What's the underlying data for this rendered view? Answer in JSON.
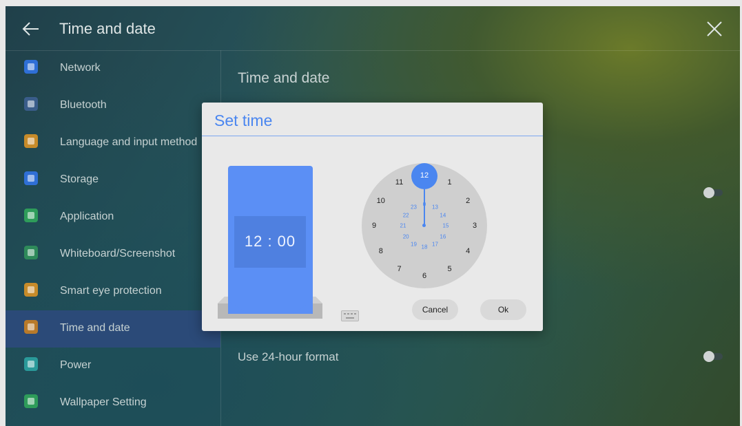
{
  "header": {
    "title": "Time and date",
    "back_icon": "arrow-left-icon",
    "close_icon": "close-icon"
  },
  "sidebar": {
    "items": [
      {
        "label": "Network",
        "icon": "globe-icon",
        "color": "#2f6fd6"
      },
      {
        "label": "Bluetooth",
        "icon": "bluetooth-icon",
        "color": "#3a5d8a"
      },
      {
        "label": "Language and input method",
        "icon": "keyboard-icon",
        "color": "#c78b2a"
      },
      {
        "label": "Storage",
        "icon": "storage-icon",
        "color": "#2f6fd6"
      },
      {
        "label": "Application",
        "icon": "apps-icon",
        "color": "#2e9c5a"
      },
      {
        "label": "Whiteboard/Screenshot",
        "icon": "whiteboard-icon",
        "color": "#2e8a5a"
      },
      {
        "label": "Smart eye protection",
        "icon": "eye-icon",
        "color": "#c78b2a"
      },
      {
        "label": "Time and date",
        "icon": "calendar-icon",
        "color": "#b87a2a"
      },
      {
        "label": "Power",
        "icon": "power-icon",
        "color": "#2a9a9a"
      },
      {
        "label": "Wallpaper Setting",
        "icon": "image-icon",
        "color": "#2e9c5a"
      }
    ],
    "active_index": 7
  },
  "main": {
    "title": "Time and date",
    "row_24h_label": "Use 24-hour format"
  },
  "dialog": {
    "title": "Set time",
    "time_value": "12 : 00",
    "clock_outer": [
      "12",
      "1",
      "2",
      "3",
      "4",
      "5",
      "6",
      "7",
      "8",
      "9",
      "10",
      "11"
    ],
    "clock_inner": [
      "0",
      "13",
      "14",
      "15",
      "16",
      "17",
      "18",
      "19",
      "20",
      "21",
      "22",
      "23"
    ],
    "selected": "12",
    "cancel_label": "Cancel",
    "ok_label": "Ok",
    "accent": "#4a86f0"
  }
}
